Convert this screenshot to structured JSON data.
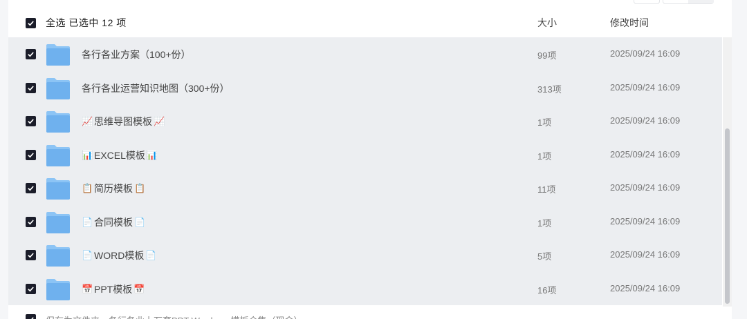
{
  "header": {
    "select_all_label": "全选  已选中  12  项",
    "col_size": "大小",
    "col_time": "修改时间"
  },
  "rows": [
    {
      "prefix": "",
      "name": "各行各业方案（100+份）",
      "suffix": "",
      "count": "99项",
      "time": "2025/09/24 16:09"
    },
    {
      "prefix": "",
      "name": "各行各业运营知识地图（300+份）",
      "suffix": "",
      "count": "313项",
      "time": "2025/09/24 16:09"
    },
    {
      "prefix": "📈",
      "name": "思维导图模板",
      "suffix": "📈",
      "count": "1项",
      "time": "2025/09/24 16:09"
    },
    {
      "prefix": "📊",
      "name": "EXCEL模板",
      "suffix": "📊",
      "count": "1项",
      "time": "2025/09/24 16:09"
    },
    {
      "prefix": "📋",
      "name": "简历模板",
      "suffix": "📋",
      "count": "11项",
      "time": "2025/09/24 16:09"
    },
    {
      "prefix": "📄",
      "name": "合同模板",
      "suffix": "📄",
      "count": "1项",
      "time": "2025/09/24 16:09"
    },
    {
      "prefix": "📄",
      "name": "WORD模板",
      "suffix": "📄",
      "count": "5项",
      "time": "2025/09/24 16:09"
    },
    {
      "prefix": "📅",
      "name": "PPT模板",
      "suffix": "📅",
      "count": "16项",
      "time": "2025/09/24 16:09"
    }
  ],
  "next_row": {
    "name": "保存为文件夹，各行各业上万套PPT Word……模板合集（现金）"
  },
  "colors": {
    "accent_checkbox": "#1b1d2a",
    "folder_blue": "#7fbcf2",
    "row_selected_bg": "#eceef1"
  }
}
